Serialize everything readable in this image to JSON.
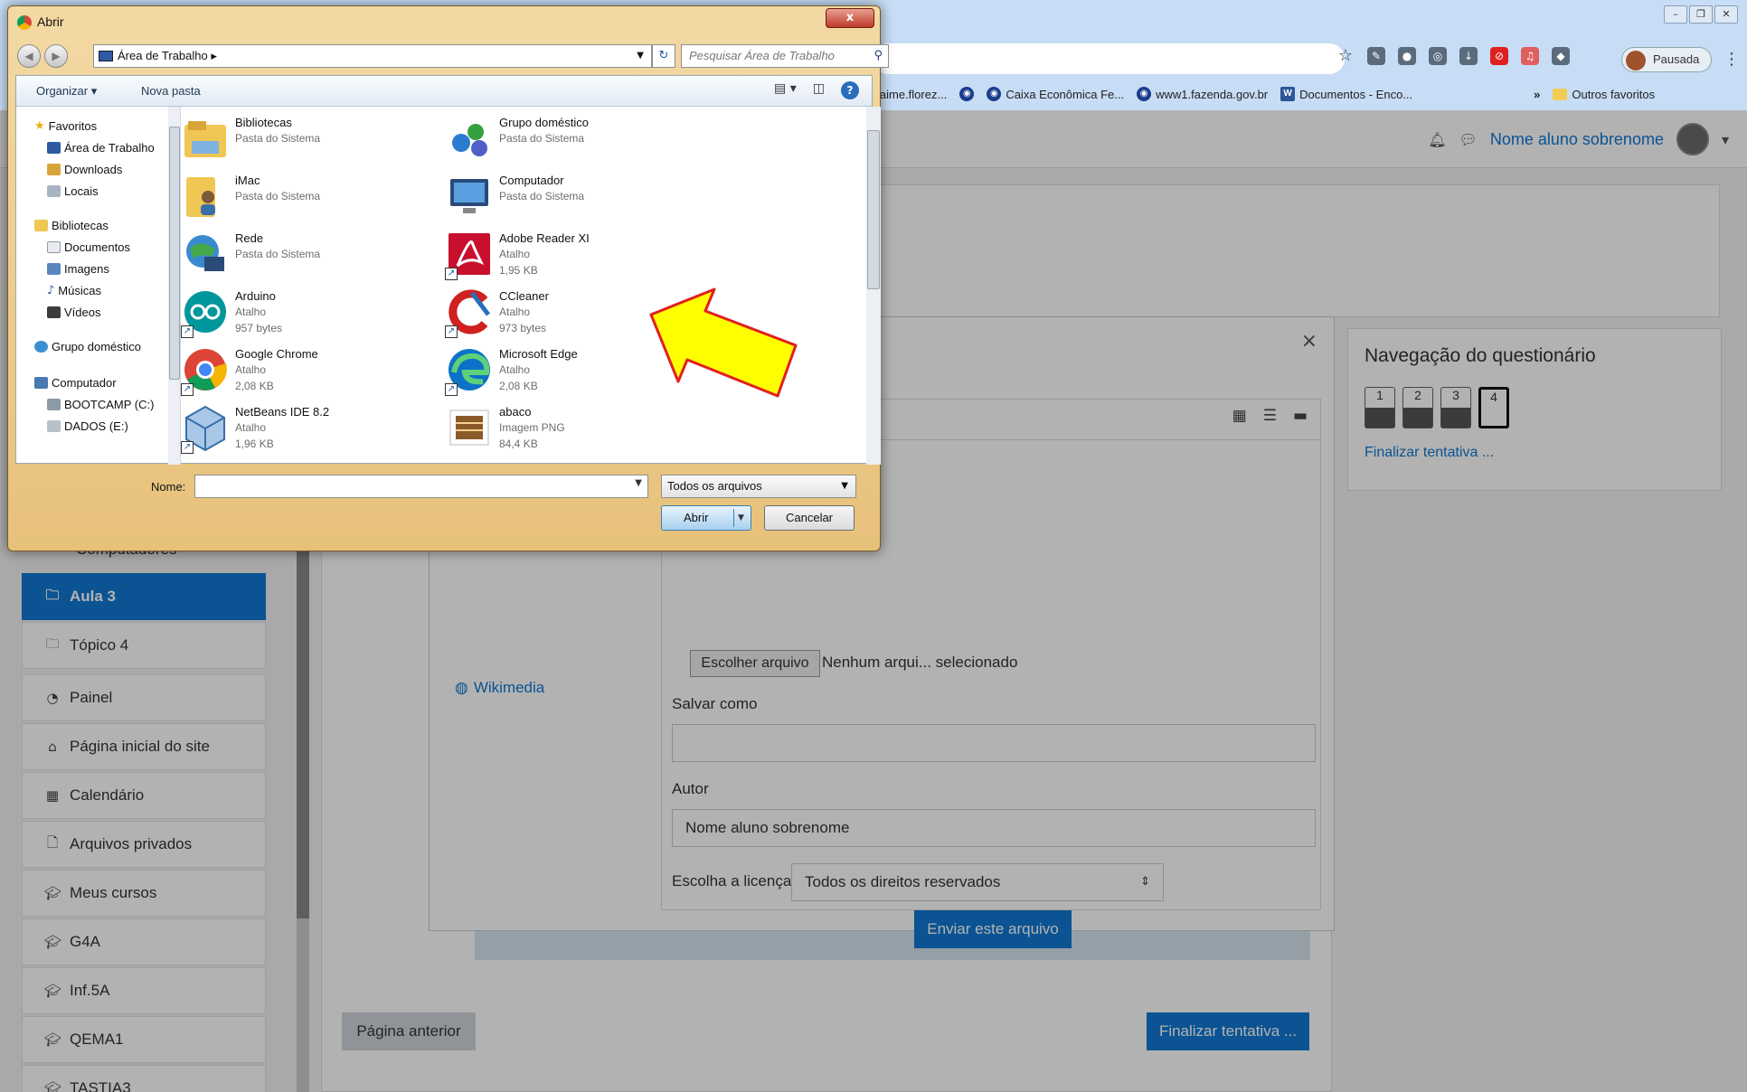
{
  "browser": {
    "profile_label": "Pausada",
    "bookmarks": [
      "jaime.florez...",
      "Caixa Econômica Fe...",
      "www1.fazenda.gov.br",
      "Documentos - Enco..."
    ],
    "bookmarks_more": "»",
    "other_favorites": "Outros favoritos"
  },
  "moodle": {
    "user_name": "Nome aluno sobrenome",
    "course_link": "putadores",
    "nav_computadores": "Computadores",
    "nav_items": [
      {
        "label": "Aula 3",
        "icon": "folder-icon"
      },
      {
        "label": "Tópico 4",
        "icon": "folder-icon"
      },
      {
        "label": "Painel",
        "icon": "dashboard-icon"
      },
      {
        "label": "Página inicial do site",
        "icon": "home-icon"
      },
      {
        "label": "Calendário",
        "icon": "calendar-icon"
      },
      {
        "label": "Arquivos privados",
        "icon": "file-icon"
      },
      {
        "label": "Meus cursos",
        "icon": "graduation-cap-icon"
      },
      {
        "label": "G4A",
        "icon": "graduation-cap-icon"
      },
      {
        "label": "Inf.5A",
        "icon": "graduation-cap-icon"
      },
      {
        "label": "QEMA1",
        "icon": "graduation-cap-icon"
      },
      {
        "label": "TASTIA3",
        "icon": "graduation-cap-icon"
      }
    ],
    "quiz_nav": {
      "title": "Navegação do questionário",
      "buttons": [
        "1",
        "2",
        "3",
        "4"
      ],
      "finish": "Finalizar tentativa ..."
    },
    "prev_page": "Página anterior",
    "finish_attempt": "Finalizar tentativa ...",
    "file_picker": {
      "close": "×",
      "repo_wikimedia": "Wikimedia",
      "choose_button": "Escolher arquivo",
      "choose_status": "Nenhum arqui... selecionado",
      "save_as_label": "Salvar como",
      "save_as_value": "",
      "author_label": "Autor",
      "author_value": "Nome aluno sobrenome",
      "license_label": "Escolha a licença",
      "license_value": "Todos os direitos reservados",
      "upload_button": "Enviar este arquivo"
    }
  },
  "dialog": {
    "title": "Abrir",
    "close": "x",
    "address": "Área de Trabalho",
    "search_placeholder": "Pesquisar Área de Trabalho",
    "organize": "Organizar ▾",
    "new_folder": "Nova pasta",
    "tree": {
      "favorites": "Favoritos",
      "desktop": "Área de Trabalho",
      "downloads": "Downloads",
      "locais": "Locais",
      "libraries": "Bibliotecas",
      "documents": "Documentos",
      "images": "Imagens",
      "music": "Músicas",
      "videos": "Vídeos",
      "homegroup": "Grupo doméstico",
      "computer": "Computador",
      "drive_c": "BOOTCAMP (C:)",
      "drive_e": "DADOS (E:)"
    },
    "files": [
      {
        "name": "Bibliotecas",
        "type": "Pasta do Sistema",
        "size": "",
        "icon": "libraries-icon"
      },
      {
        "name": "Grupo doméstico",
        "type": "Pasta do Sistema",
        "size": "",
        "icon": "homegroup-icon"
      },
      {
        "name": "iMac",
        "type": "Pasta do Sistema",
        "size": "",
        "icon": "user-folder-icon"
      },
      {
        "name": "Computador",
        "type": "Pasta do Sistema",
        "size": "",
        "icon": "computer-icon"
      },
      {
        "name": "Rede",
        "type": "Pasta do Sistema",
        "size": "",
        "icon": "network-icon"
      },
      {
        "name": "Adobe Reader XI",
        "type": "Atalho",
        "size": "1,95 KB",
        "icon": "adobe-reader-icon"
      },
      {
        "name": "Arduino",
        "type": "Atalho",
        "size": "957 bytes",
        "icon": "arduino-icon"
      },
      {
        "name": "CCleaner",
        "type": "Atalho",
        "size": "973 bytes",
        "icon": "ccleaner-icon"
      },
      {
        "name": "Google Chrome",
        "type": "Atalho",
        "size": "2,08 KB",
        "icon": "chrome-icon"
      },
      {
        "name": "Microsoft Edge",
        "type": "Atalho",
        "size": "2,08 KB",
        "icon": "edge-icon"
      },
      {
        "name": "NetBeans IDE 8.2",
        "type": "Atalho",
        "size": "1,96 KB",
        "icon": "netbeans-icon"
      },
      {
        "name": "abaco",
        "type": "Imagem PNG",
        "size": "84,4 KB",
        "icon": "png-image-icon"
      }
    ],
    "name_label": "Nome:",
    "name_value": "",
    "file_type": "Todos os arquivos",
    "open_button": "Abrir",
    "cancel_button": "Cancelar"
  },
  "colors": {
    "moodle_blue": "#1177d1",
    "arrow_fill": "#ffff00",
    "arrow_stroke": "#e02020",
    "dialog_frame": "#e7c17a"
  }
}
